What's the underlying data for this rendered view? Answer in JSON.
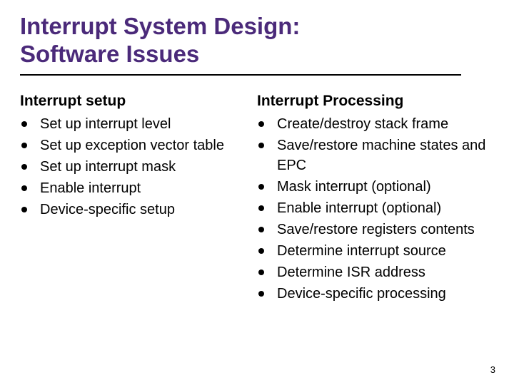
{
  "title_line1": "Interrupt System Design:",
  "title_line2": "Software Issues",
  "columns": [
    {
      "heading": "Interrupt setup",
      "items": [
        "Set up interrupt level",
        "Set up exception vector table",
        "Set up interrupt mask",
        "Enable interrupt",
        "Device-specific setup"
      ]
    },
    {
      "heading": "Interrupt Processing",
      "items": [
        "Create/destroy stack frame",
        "Save/restore machine states and EPC",
        "Mask interrupt (optional)",
        "Enable interrupt (optional)",
        "Save/restore registers contents",
        "Determine interrupt source",
        "Determine ISR address",
        "Device-specific processing"
      ]
    }
  ],
  "page_number": "3"
}
